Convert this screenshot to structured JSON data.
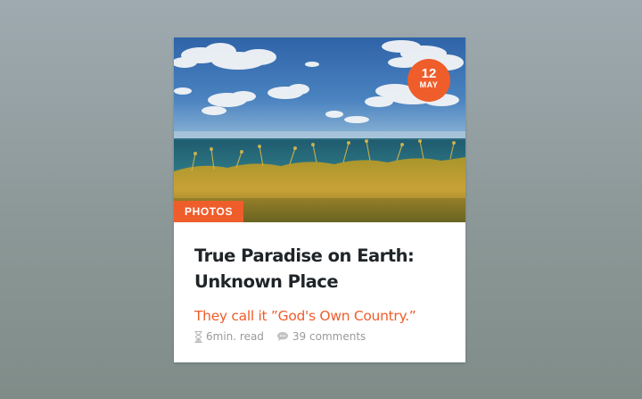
{
  "card": {
    "date": {
      "day": "12",
      "month": "MAY"
    },
    "category": "PHOTOS",
    "title": "True Paradise on Earth: Unknown Place",
    "subtitle": "They call it ”God's Own Country.”",
    "meta": {
      "read_time": "6min. read",
      "read_time_icon": "hourglass-icon",
      "comments": "39 comments",
      "comments_icon": "comment-bubble-icon"
    }
  },
  "colors": {
    "accent": "#ef5d2b",
    "title": "#1f2428",
    "meta": "#9a9a9a",
    "card_bg": "#ffffff"
  }
}
